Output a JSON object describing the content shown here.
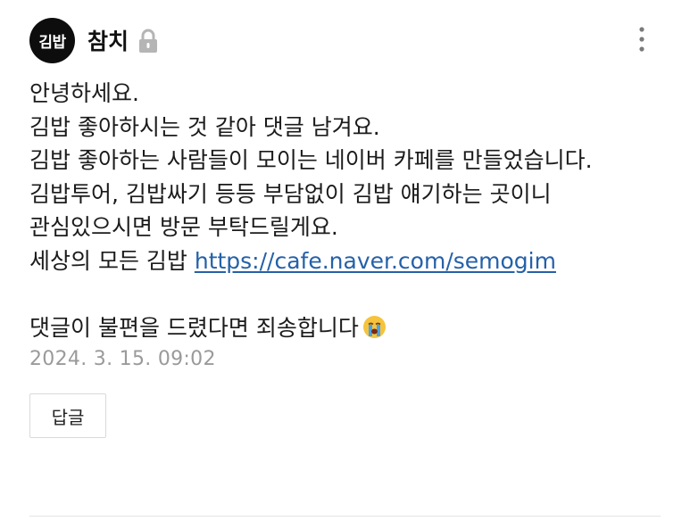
{
  "comment": {
    "avatar_text": "김밥",
    "author": "참치",
    "lock_icon": "lock-icon",
    "more_icon": "vertical-dots-icon",
    "lines": [
      "안녕하세요.",
      "김밥 좋아하시는 것 같아 댓글 남겨요.",
      "김밥 좋아하는 사람들이 모이는 네이버 카페를 만들었습니다.",
      "김밥투어, 김밥싸기 등등 부담없이 김밥 얘기하는 곳이니",
      "관심있으시면 방문 부탁드릴게요."
    ],
    "link_prefix": "세상의 모든 김밥 ",
    "link_text": "https://cafe.naver.com/semogim",
    "closing_text": "댓글이 불편을 드렸다면 죄송합니다",
    "closing_emoji": "crying-face-emoji",
    "timestamp": "2024. 3. 15. 09:02",
    "reply_label": "답글"
  },
  "colors": {
    "link": "#2561a8",
    "timestamp": "#9a9a9a",
    "avatar_bg": "#0d0d0d",
    "border": "#d9d9d9"
  }
}
